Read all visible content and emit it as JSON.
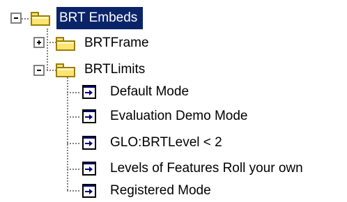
{
  "tree": {
    "root": {
      "label": "BRT Embeds",
      "expander": "−",
      "icon": "folder-icon",
      "selected": true,
      "children": [
        {
          "label": "BRTFrame",
          "expander": "+",
          "icon": "folder-icon"
        },
        {
          "label": "BRTLimits",
          "expander": "−",
          "icon": "folder-icon",
          "children": [
            {
              "label": "Default Mode",
              "icon": "document-icon"
            },
            {
              "label": "Evaluation Demo Mode",
              "icon": "document-icon"
            },
            {
              "label": "GLO:BRTLevel < 2",
              "icon": "document-icon"
            },
            {
              "label": "Levels of Features Roll your own",
              "icon": "document-icon"
            },
            {
              "label": "Registered Mode",
              "icon": "document-icon"
            }
          ]
        }
      ]
    }
  },
  "colors": {
    "selection_bg": "#0a246a",
    "selection_text": "#ffffff",
    "tree_line": "#808080",
    "folder_fill": "#ffe472"
  }
}
